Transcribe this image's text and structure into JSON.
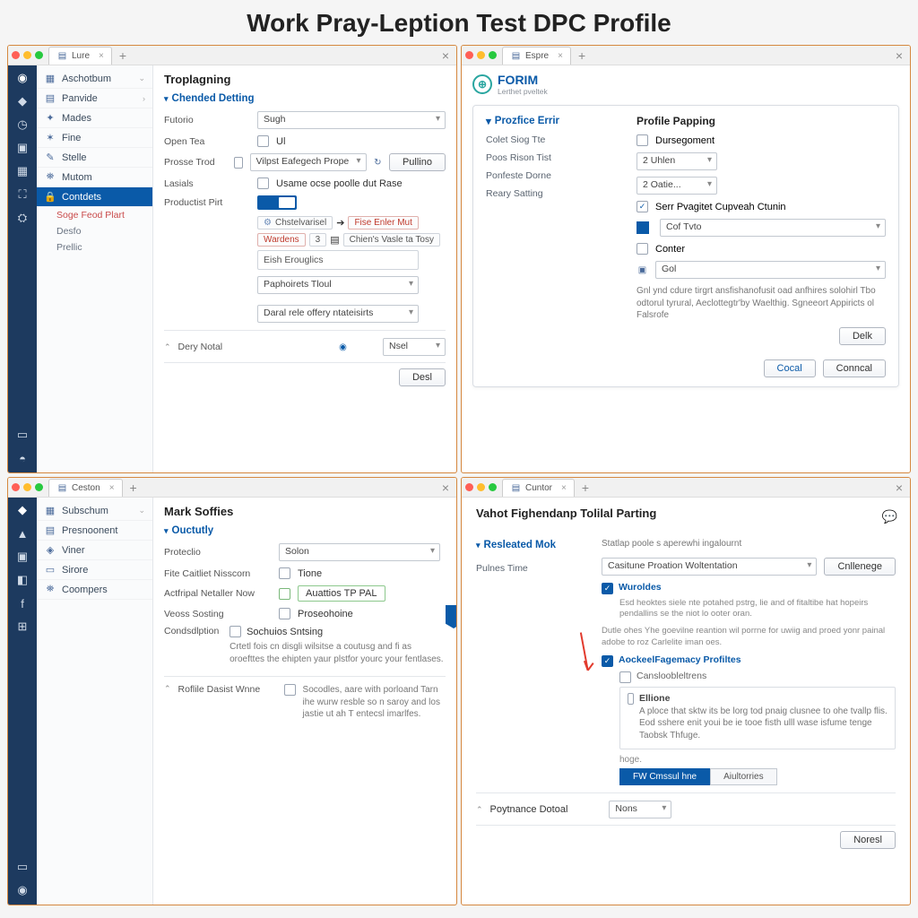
{
  "title": "Work Pray-Leption Test DPC Profile",
  "p1": {
    "tab": "Lure",
    "sidebar": [
      "Aschotbum",
      "Panvide",
      "Mades",
      "Fine",
      "Stelle",
      "Mutom"
    ],
    "active": "Contdets",
    "sub": [
      "Soge Feod Plart",
      "Desfo",
      "Prellic"
    ],
    "heading": "Troplagning",
    "sect": "Chended Detting",
    "rows": {
      "r1": {
        "label": "Futorio",
        "value": "Sugh"
      },
      "r2": {
        "label": "Open Tea",
        "check": "Ul"
      },
      "r3": {
        "label": "Prosse Trod",
        "value": "Vilpst Eafegech Prope",
        "btn": "Pullino"
      },
      "r4": {
        "label": "Lasials",
        "check": "Usame ocse poolle dut Rase"
      },
      "r5": {
        "label": "Productist Pirt"
      }
    },
    "tags1": {
      "g": "Chstelvarisel",
      "r": "Fise Enler Mut"
    },
    "tags2": {
      "a": "Wardens",
      "n": "3",
      "b": "Chien's Vasle ta Tosy"
    },
    "box1": "Eish Erouglics",
    "sel1": "Paphoirets Tloul",
    "sel2": "Daral rele offery ntateisirts",
    "footer_label": "Dery Notal",
    "next": "Nsel",
    "done": "Desl"
  },
  "p2": {
    "tab": "Espre",
    "brand": "FORIM",
    "brand_sub": "Lerthet pveltek",
    "left_hdr": "Prozfice Errir",
    "left_items": [
      "Colet Siog Tte",
      "Poos Rison Tist",
      "Ponfeste Dorne",
      "Reary Satting"
    ],
    "right_hdr": "Profile Papping",
    "chk1": "Dursegoment",
    "sel1": "2 Uhlen",
    "sel2": "2 Oatie...",
    "chk2": "Serr Pvagitet Cupveah Ctunin",
    "sel3": "Cof Tvto",
    "chk3": "Conter",
    "sel4": "Gol",
    "help": "Gnl ynd cdure tirgrt ansfishanofusit oad anfhires solohirl Tbo odtorul tyrural, Aeclottegtr'by Waelthig. Sgneeort Appiricts ol Falsrofe",
    "delk": "Delk",
    "cocal": "Cocal",
    "cancel": "Conncal"
  },
  "p3": {
    "tab": "Ceston",
    "sidebar": [
      "Subschum",
      "Presnoonent",
      "Viner",
      "Sirore",
      "Coompers"
    ],
    "heading": "Mark Soffies",
    "sect": "Ouctutly",
    "rows": {
      "r1": {
        "label": "Proteclio",
        "value": "Solon"
      },
      "r2": {
        "label": "Fite Caitliet Nisscorn",
        "check": "Tione"
      },
      "r3": {
        "label": "Actfripal Netaller Now",
        "check": "Auattios TP PAL"
      },
      "r4": {
        "label": "Veoss Sosting",
        "check": "Proseohoine"
      },
      "r5": {
        "label": "Condsdlption",
        "check": "Sochuios Sntsing"
      }
    },
    "help": "Crtetl fois cn disgli wilsitse a coutusg and fi as oroefttes the ehipten yaur plstfor yourc your fentlases.",
    "footer_label": "Roflile Dasist Wnne",
    "footer_check": "Socodles, aare with porloand Tarn ihe wurw resble so n saroy and los jastie ut ah T entecsl imarlfes."
  },
  "p4": {
    "tab": "Cuntor",
    "heading": "Vahot Fighendanp Tolilal Parting",
    "sect": "Resleated Mok",
    "label1": "Pulnes Time",
    "intro": "Statlap poole s aperewhi ingalournt",
    "sel1": "Casitune Proation Woltentation",
    "btn1": "Cnllenege",
    "chk1": "Wuroldes",
    "help1": "Esd heoktes siele nte potahed pstrg, lie and of fitaltibe hat hopeirs pendallins se the niot lo ooter oran.",
    "help2": "Dutle ohes Yhe goevilne reantion wil porrne for uwiig and proed yonr painal adobe to roz Carlelite iman oes.",
    "chk2": "AockeelFagemacy Profiltes",
    "chk3": "Cansloobleltrens",
    "inset_hdr": "Ellione",
    "inset_body": "A ploce that sktw its be lorg tod pnaig clusnee to ohe tvallp flis. Eod sshere enit youi be ie tooe fisth ulll wase isfume tenge Taobsk Thfuge.",
    "hoge": "hoge.",
    "tab1": "FW Cmssul hne",
    "tab2": "Aiultorries",
    "footer_label": "Poytnance Dotoal",
    "none": "Nons",
    "done": "Noresl"
  }
}
